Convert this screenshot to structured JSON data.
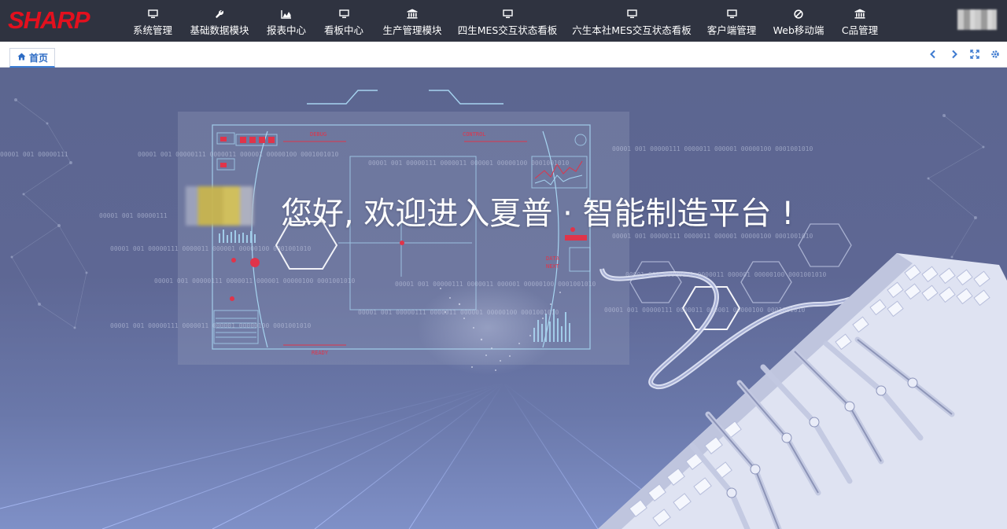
{
  "app": {
    "logo_text": "SHARP",
    "brand_color": "#e3101e"
  },
  "nav": {
    "items": [
      {
        "label": "系统管理",
        "icon": "monitor-icon"
      },
      {
        "label": "基础数据模块",
        "icon": "wrench-icon"
      },
      {
        "label": "报表中心",
        "icon": "area-chart-icon"
      },
      {
        "label": "看板中心",
        "icon": "monitor-icon"
      },
      {
        "label": "生产管理模块",
        "icon": "bank-icon"
      },
      {
        "label": "四生MES交互状态看板",
        "icon": "monitor-icon"
      },
      {
        "label": "六生本社MES交互状态看板",
        "icon": "monitor-icon"
      },
      {
        "label": "客户端管理",
        "icon": "monitor-icon"
      },
      {
        "label": "Web移动端",
        "icon": "ban-icon"
      },
      {
        "label": "C品管理",
        "icon": "bank-icon"
      }
    ]
  },
  "tabs": {
    "home_label": "首页"
  },
  "controls": [
    "chevron-left-icon",
    "chevron-right-icon",
    "expand-icon",
    "gear-icon"
  ],
  "main": {
    "welcome_text": "您好, 欢迎进入夏普 · 智能制造平台 !",
    "code_strip": "00001 001  00000111 0000011   000001  00000100 0001001010",
    "code_short": "00001 001  00000111",
    "panel_words": [
      "DEBUG",
      "CONTROL",
      "READY",
      "DATA",
      "NEXT"
    ]
  }
}
